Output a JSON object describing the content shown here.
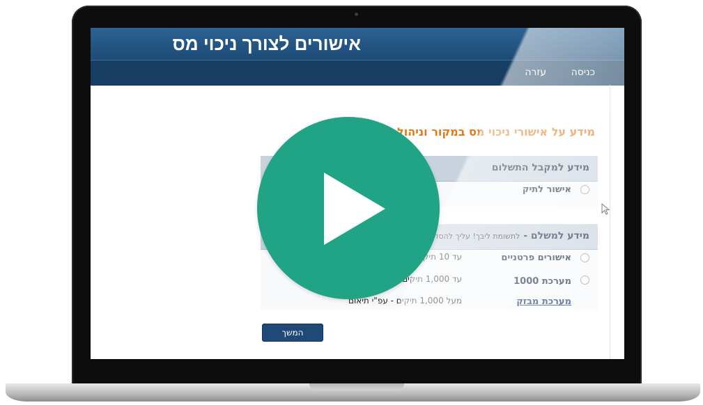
{
  "header": {
    "title": "אישורים לצורך ניכוי מס"
  },
  "nav": {
    "login_label": "כניסה",
    "help_label": "עזרה"
  },
  "main": {
    "intro_heading": "מידע על אישורי ניכוי מס במקור וניהול שרים",
    "recipient_section": {
      "heading": "מידע למקבל התשלום",
      "options": [
        {
          "label": "אישור לתיק"
        }
      ]
    },
    "payer_section": {
      "heading": "מידע למשלם -",
      "note": "לתשומת ליבך! עליך להסדיר את דרכי הגישה",
      "options": [
        {
          "label": "אישורים פרטניים",
          "desc": "עד 10 תיקים - הצגת תיקים"
        },
        {
          "label": "מערכת 1000",
          "desc": "עד 1,000 תיקים - שליחה וקבלת קובץ"
        },
        {
          "label": "מערכת מבזק",
          "desc": "מעל 1,000 תיקים - עפ\"י תיאום"
        }
      ]
    },
    "continue_label": "המשך"
  },
  "overlay": {
    "play_color": "#20a485"
  }
}
